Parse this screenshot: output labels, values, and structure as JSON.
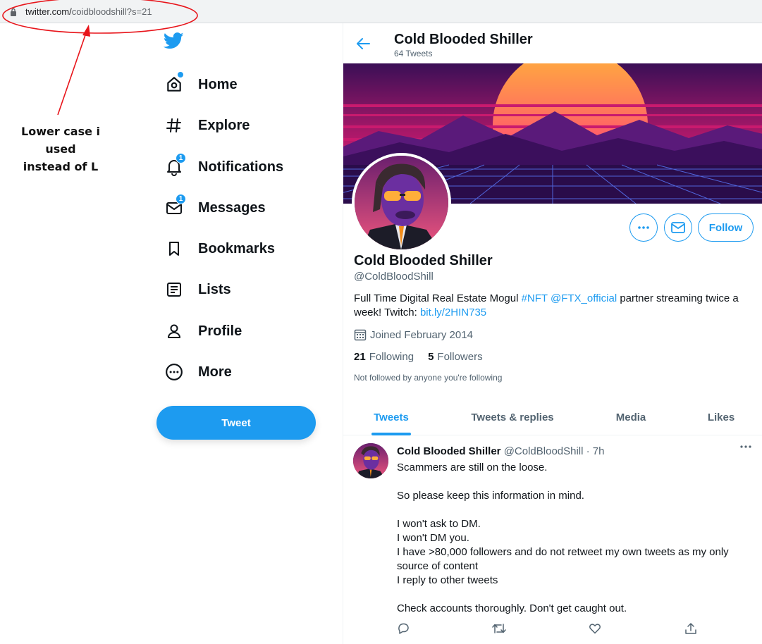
{
  "browser": {
    "url_domain": "twitter.com/",
    "url_path": "coidbloodshill?s=21"
  },
  "annotation": {
    "line1": "Lower case i used",
    "line2": "instead of L",
    "color": "#e8151b"
  },
  "nav": {
    "logo": "twitter-bird-icon",
    "items": [
      {
        "label": "Home",
        "icon": "home-icon"
      },
      {
        "label": "Explore",
        "icon": "hashtag-icon"
      },
      {
        "label": "Notifications",
        "icon": "bell-icon",
        "badge": "1"
      },
      {
        "label": "Messages",
        "icon": "envelope-icon",
        "badge": "1"
      },
      {
        "label": "Bookmarks",
        "icon": "bookmark-icon"
      },
      {
        "label": "Lists",
        "icon": "list-icon"
      },
      {
        "label": "Profile",
        "icon": "person-icon"
      },
      {
        "label": "More",
        "icon": "more-circle-icon"
      }
    ],
    "tweet_button": "Tweet"
  },
  "header": {
    "name": "Cold Blooded Shiller",
    "tweet_count": "64 Tweets"
  },
  "profile": {
    "name": "Cold Blooded Shiller",
    "handle": "@ColdBloodShill",
    "bio_text1": "Full Time Digital Real Estate Mogul ",
    "bio_hashtag": "#NFT",
    "bio_mention": "@FTX_official",
    "bio_text2": " partner streaming twice a week! Twitch: ",
    "bio_link": "bit.ly/2HIN735",
    "joined": "Joined February 2014",
    "following_count": "21",
    "following_label": "Following",
    "followers_count": "5",
    "followers_label": "Followers",
    "not_followed": "Not followed by anyone you're following",
    "follow_button": "Follow"
  },
  "tabs": [
    {
      "label": "Tweets",
      "active": true
    },
    {
      "label": "Tweets & replies",
      "active": false
    },
    {
      "label": "Media",
      "active": false
    },
    {
      "label": "Likes",
      "active": false
    }
  ],
  "tweet": {
    "name": "Cold Blooded Shiller",
    "meta": "@ColdBloodShill · 7h",
    "lines": [
      "Scammers are still on the loose.",
      "",
      "So please keep this information in mind.",
      "",
      "I won't ask to DM.",
      "I won't DM you.",
      "I have >80,000 followers and do not retweet my own tweets as my only source of content",
      "I reply to other tweets",
      "",
      "Check accounts thoroughly. Don't get caught out."
    ],
    "actions": [
      "reply-icon",
      "retweet-icon",
      "like-icon",
      "share-icon"
    ]
  },
  "colors": {
    "accent": "#1d9bf0",
    "text": "#0f1419",
    "muted": "#536471"
  }
}
